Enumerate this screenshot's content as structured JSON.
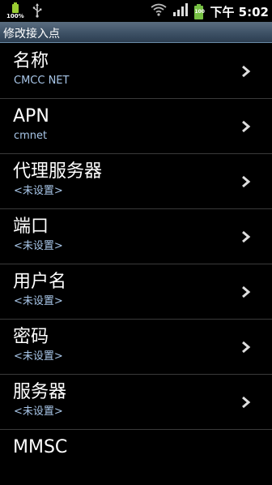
{
  "status": {
    "battery_percent_label": "100%",
    "charging_label": "100",
    "time": "下午 5:02"
  },
  "header": {
    "title": "修改接入点"
  },
  "items": [
    {
      "title": "名称",
      "value": "CMCC NET"
    },
    {
      "title": "APN",
      "value": "cmnet"
    },
    {
      "title": "代理服务器",
      "value": "<未设置>"
    },
    {
      "title": "端口",
      "value": "<未设置>"
    },
    {
      "title": "用户名",
      "value": "<未设置>"
    },
    {
      "title": "密码",
      "value": "<未设置>"
    },
    {
      "title": "服务器",
      "value": "<未设置>"
    },
    {
      "title": "MMSC",
      "value": ""
    }
  ]
}
